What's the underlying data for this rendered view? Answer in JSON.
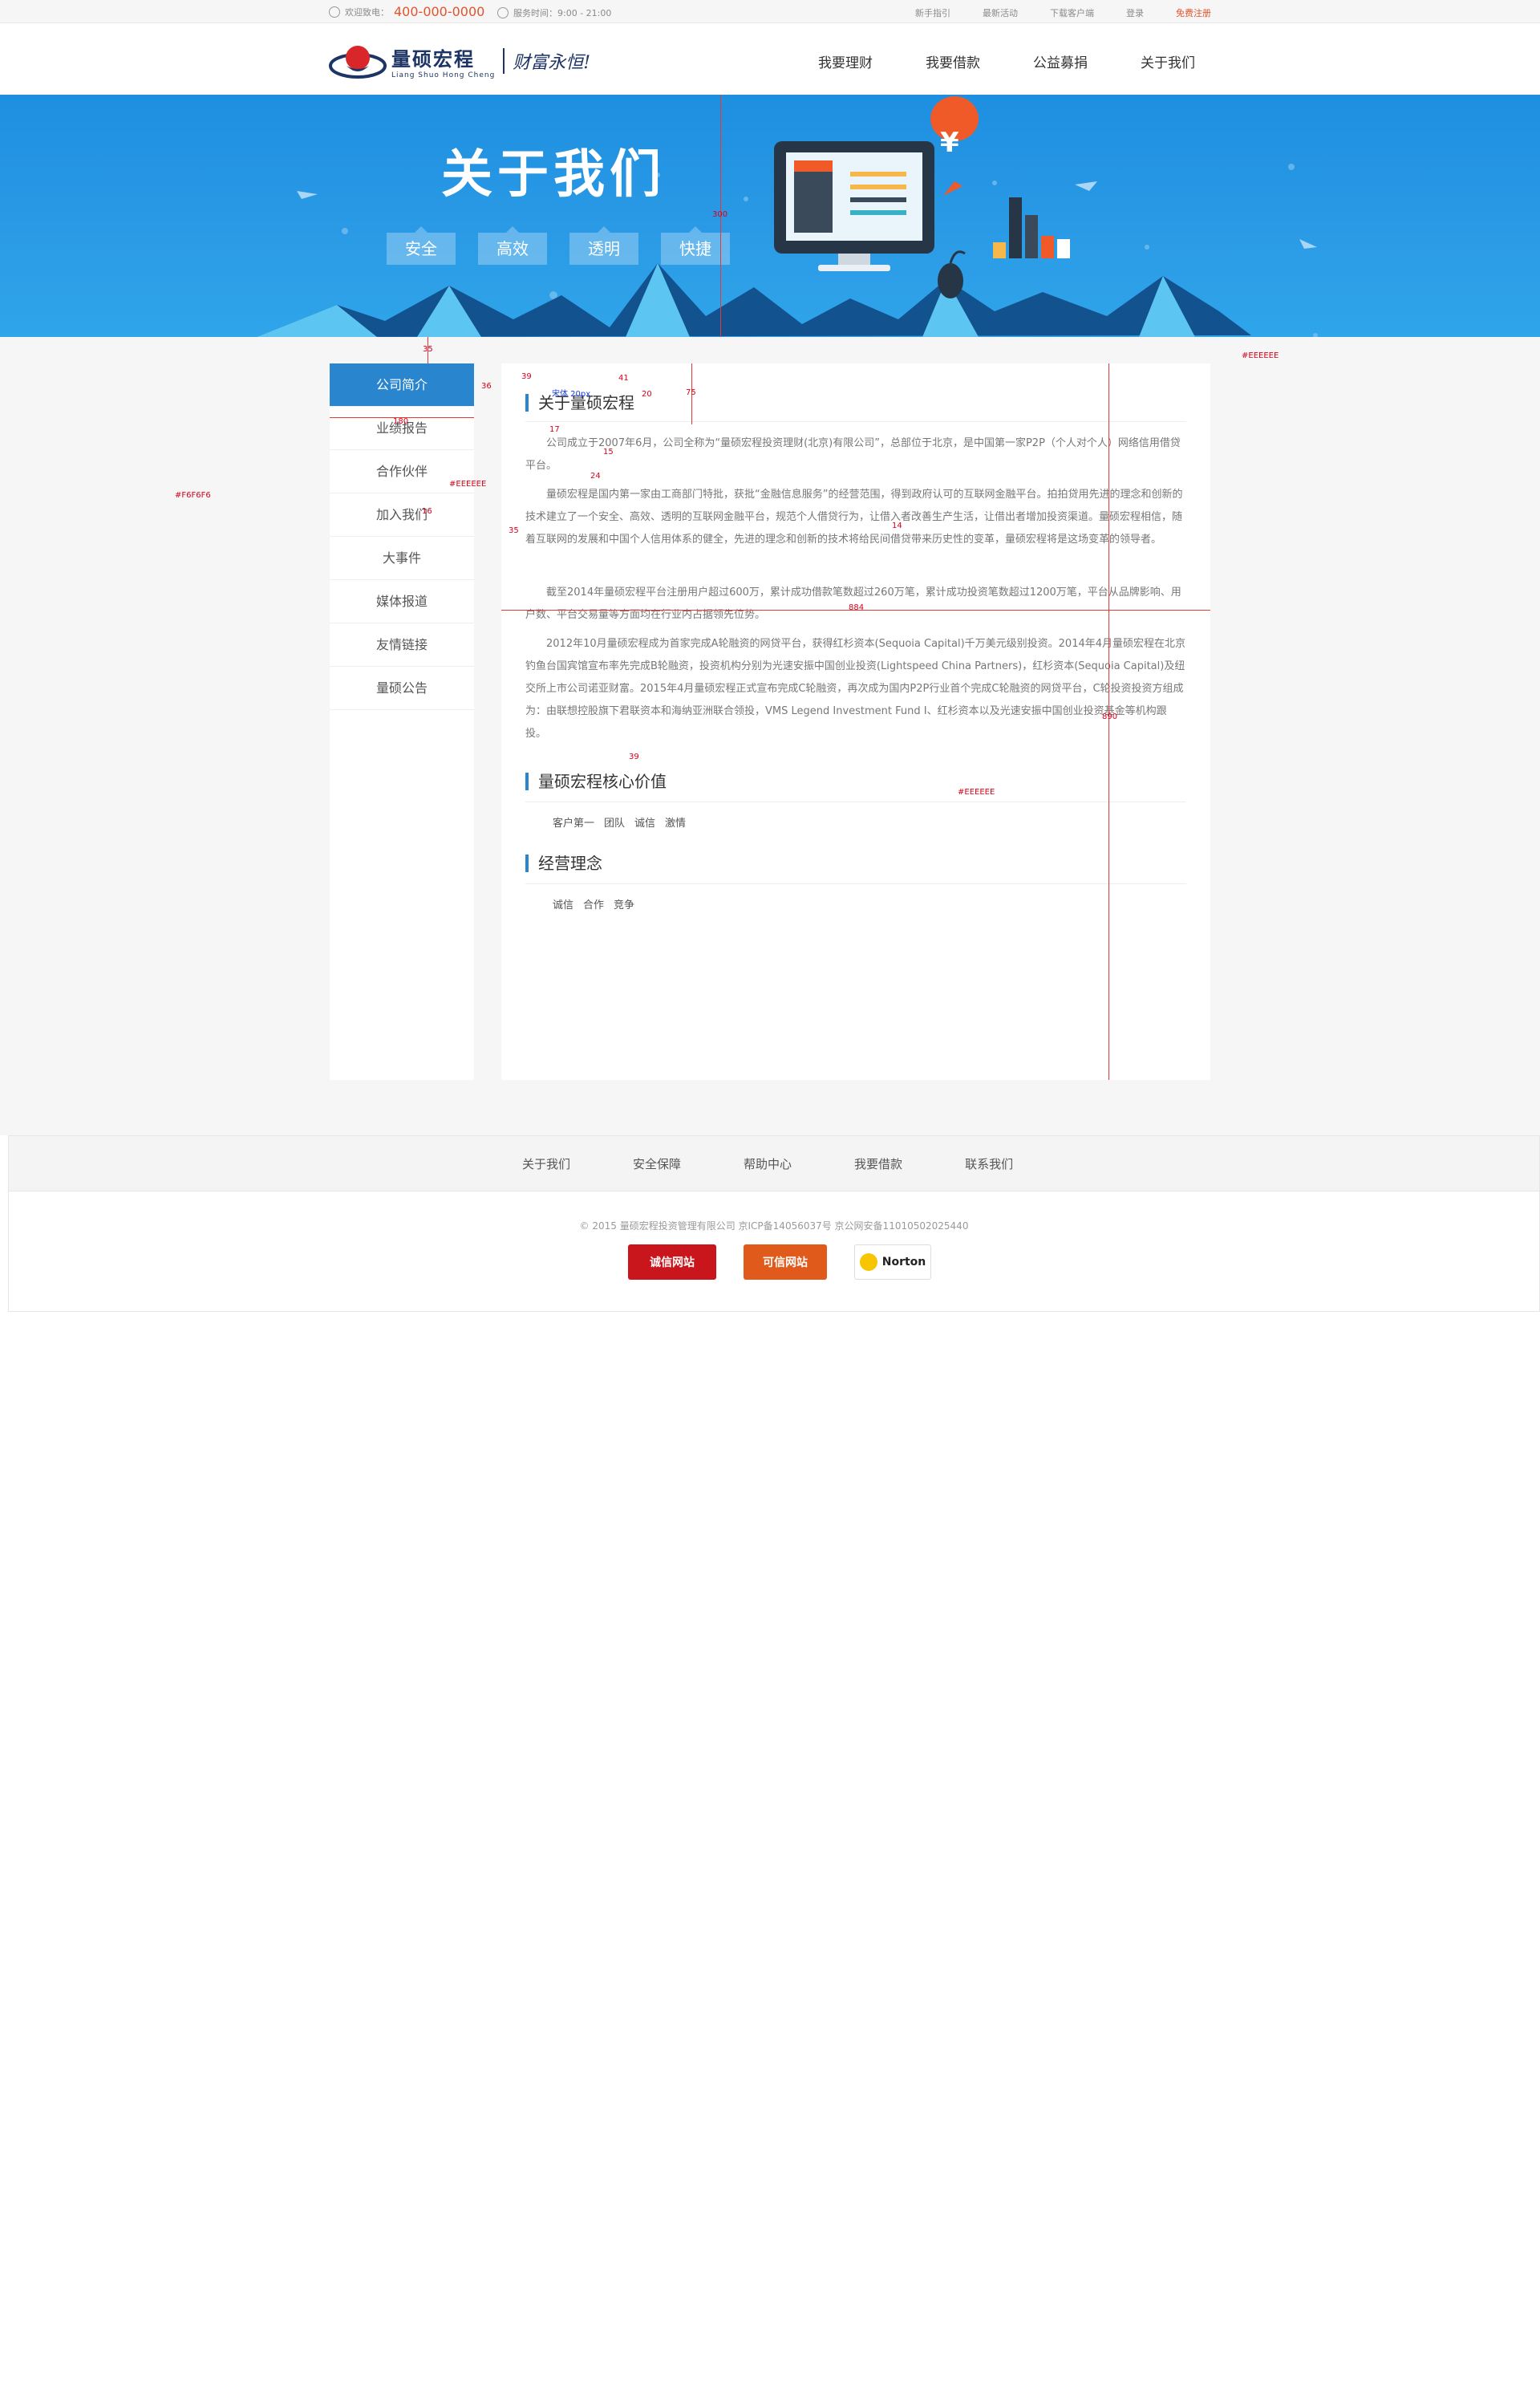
{
  "topbar": {
    "hotline_label": "欢迎致电：",
    "hotline_number": "400-000-0000",
    "hours": "服务时间：9:00 - 21:00",
    "links": [
      "新手指引",
      "最新活动",
      "下载客户端",
      "登录",
      "免费注册"
    ]
  },
  "logo": {
    "cn": "量硕宏程",
    "pinyin": "Liang Shuo Hong Cheng",
    "slogan": "财富永恒!"
  },
  "nav": [
    "我要理财",
    "我要借款",
    "公益募捐",
    "关于我们"
  ],
  "banner": {
    "title": "关于我们",
    "tags": [
      "安全",
      "高效",
      "透明",
      "快捷"
    ]
  },
  "sidebar": [
    "公司简介",
    "业绩报告",
    "合作伙伴",
    "加入我们",
    "大事件",
    "媒体报道",
    "友情链接",
    "量硕公告"
  ],
  "main": {
    "section1_title": "关于量硕宏程",
    "paragraphs": [
      "公司成立于2007年6月，公司全称为“量硕宏程投资理财(北京)有限公司”，总部位于北京，是中国第一家P2P（个人对个人）网络信用借贷平台。",
      "量硕宏程是国内第一家由工商部门特批，获批“金融信息服务”的经营范围，得到政府认可的互联网金融平台。拍拍贷用先进的理念和创新的技术建立了一个安全、高效、透明的互联网金融平台，规范个人借贷行为，让借入者改善生产生活，让借出者增加投资渠道。量硕宏程相信，随着互联网的发展和中国个人信用体系的健全，先进的理念和创新的技术将给民间借贷带来历史性的变革，量硕宏程将是这场变革的领导者。",
      "截至2014年量硕宏程平台注册用户超过600万，累计成功借款笔数超过260万笔，累计成功投资笔数超过1200万笔，平台从品牌影响、用户数、平台交易量等方面均在行业内占据领先位势。",
      "2012年10月量硕宏程成为首家完成A轮融资的网贷平台，获得红杉资本(Sequoia Capital)千万美元级别投资。2014年4月量硕宏程在北京钓鱼台国宾馆宣布率先完成B轮融资，投资机构分别为光速安振中国创业投资(Lightspeed China Partners)，红杉资本(Sequoia Capital)及纽交所上市公司诺亚财富。2015年4月量硕宏程正式宣布完成C轮融资，再次成为国内P2P行业首个完成C轮融资的网贷平台，C轮投资投资方组成为：由联想控股旗下君联资本和海纳亚洲联合领投，VMS Legend Investment Fund I、红杉资本以及光速安振中国创业投资基金等机构跟投。"
    ],
    "section2_title": "量硕宏程核心价值",
    "values": [
      "客户第一",
      "团队",
      "诚信",
      "激情"
    ],
    "section3_title": "经营理念",
    "ideas": [
      "诚信",
      "合作",
      "竞争"
    ]
  },
  "footer": {
    "links": [
      "关于我们",
      "安全保障",
      "帮助中心",
      "我要借款",
      "联系我们"
    ],
    "copyright": "© 2015 量硕宏程投资管理有限公司 京ICP备14056037号 京公网安备11010502025440",
    "badges": [
      "诚信网站",
      "可信网站",
      "Norton"
    ]
  },
  "annotations": {
    "banner_height": "300",
    "sidebar_gap": "35",
    "side_gap": "36",
    "side_width": "180",
    "color_grey": "#EEEEEE",
    "color_bg": "#F6F6F6",
    "main_width": "884",
    "main_height": "890",
    "title_gap": "75",
    "spacing_39": "39",
    "spacing_41": "41",
    "spacing_17": "17",
    "spacing_15": "15",
    "spacing_24": "24",
    "spacing_14": "14",
    "spacing_16": "16",
    "spacing_20": "20",
    "spacing_35": "35",
    "title_size_label": "宋体 20px"
  },
  "colors": {
    "accent": "#2a85cf",
    "hotline": "#e4532c",
    "banner": "#1e8fe0"
  }
}
